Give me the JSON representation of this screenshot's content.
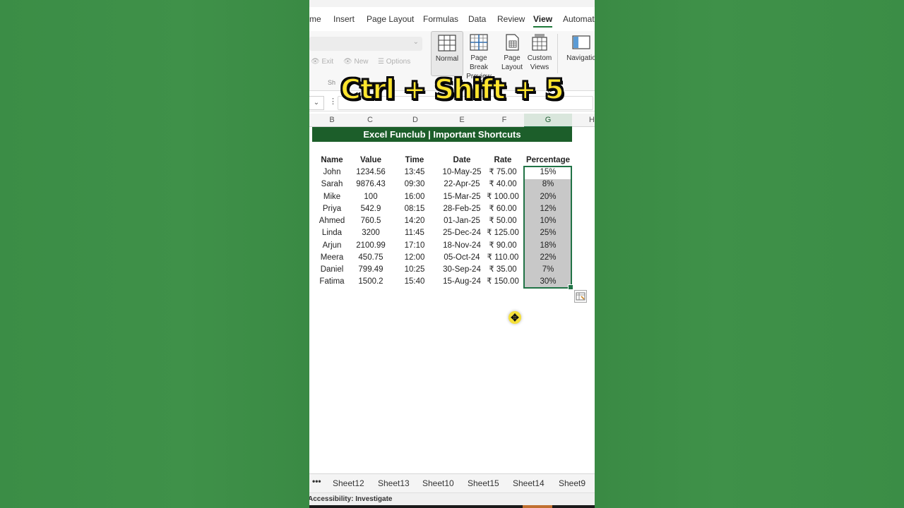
{
  "ribbon": {
    "tabs": [
      "me",
      "Insert",
      "Page Layout",
      "Formulas",
      "Data",
      "Review",
      "View",
      "Automate"
    ],
    "active_tab": "View",
    "sheet_view": {
      "exit_label": "Exit",
      "new_label": "New",
      "options_label": "Options",
      "group_label": "Sh"
    },
    "workbook_views": [
      {
        "label": "Normal",
        "icon": "normal-view-icon"
      },
      {
        "label": "Page Break Preview",
        "icon": "page-break-icon"
      },
      {
        "label": "Page Layout",
        "icon": "page-layout-icon"
      },
      {
        "label": "Custom Views",
        "icon": "custom-views-icon"
      }
    ],
    "navigation_label": "Navigatio"
  },
  "formula_bar": {
    "more": "⋮"
  },
  "columns": [
    "B",
    "C",
    "D",
    "E",
    "F",
    "G",
    "H"
  ],
  "selected_column": "G",
  "sheet": {
    "banner": "Excel Funclub | Important Shortcuts",
    "headers": [
      "Name",
      "Value",
      "Time",
      "Date",
      "Rate",
      "Percentage"
    ],
    "rows": [
      [
        "John",
        "1234.56",
        "13:45",
        "10-May-25",
        "₹ 75.00",
        "15%"
      ],
      [
        "Sarah",
        "9876.43",
        "09:30",
        "22-Apr-25",
        "₹ 40.00",
        "8%"
      ],
      [
        "Mike",
        "100",
        "16:00",
        "15-Mar-25",
        "₹ 100.00",
        "20%"
      ],
      [
        "Priya",
        "542.9",
        "08:15",
        "28-Feb-25",
        "₹ 60.00",
        "12%"
      ],
      [
        "Ahmed",
        "760.5",
        "14:20",
        "01-Jan-25",
        "₹ 50.00",
        "10%"
      ],
      [
        "Linda",
        "3200",
        "11:45",
        "25-Dec-24",
        "₹ 125.00",
        "25%"
      ],
      [
        "Arjun",
        "2100.99",
        "17:10",
        "18-Nov-24",
        "₹ 90.00",
        "18%"
      ],
      [
        "Meera",
        "450.75",
        "12:00",
        "05-Oct-24",
        "₹ 110.00",
        "22%"
      ],
      [
        "Daniel",
        "799.49",
        "10:25",
        "30-Sep-24",
        "₹ 35.00",
        "7%"
      ],
      [
        "Fatima",
        "1500.2",
        "15:40",
        "15-Aug-24",
        "₹ 150.00",
        "30%"
      ]
    ]
  },
  "overlay": {
    "shortcut": "Ctrl + Shift + 5"
  },
  "sheet_tabs": [
    "•••",
    "Sheet12",
    "Sheet13",
    "Sheet10",
    "Sheet15",
    "Sheet14",
    "Sheet9"
  ],
  "status": {
    "accessibility": "Accessibility: Investigate"
  },
  "colors": {
    "banner": "#1c5e2a",
    "selection_border": "#217346",
    "background": "#3a8a45",
    "overlay_text": "#ffe52e"
  }
}
